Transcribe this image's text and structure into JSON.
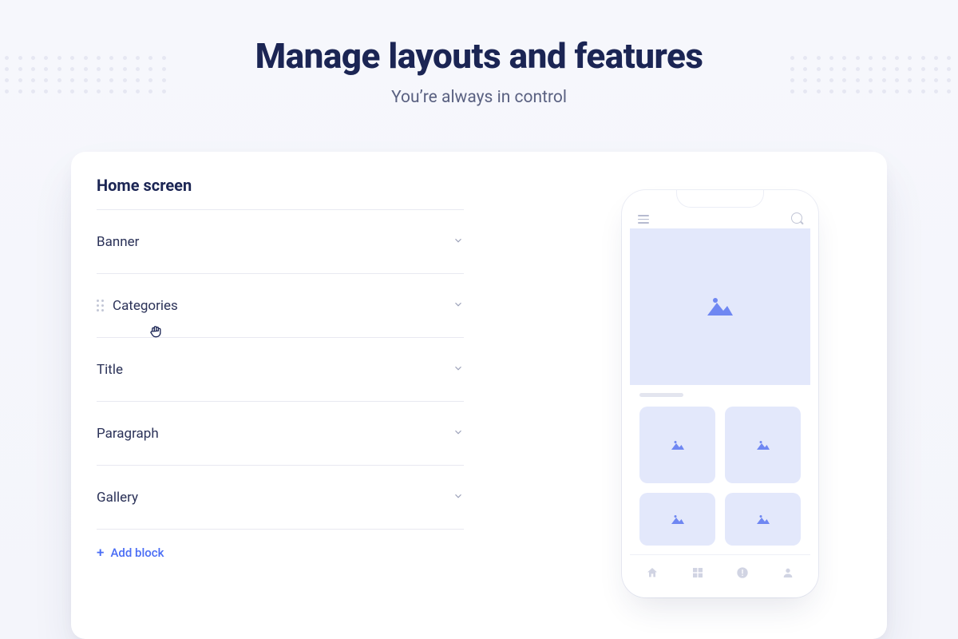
{
  "header": {
    "title": "Manage layouts and features",
    "subtitle": "You’re always in control"
  },
  "panel": {
    "title": "Home screen",
    "add_block_label": "Add block",
    "blocks": [
      {
        "label": "Banner",
        "has_drag": false,
        "has_cursor": false
      },
      {
        "label": "Categories",
        "has_drag": true,
        "has_cursor": true
      },
      {
        "label": "Title",
        "has_drag": false,
        "has_cursor": false
      },
      {
        "label": "Paragraph",
        "has_drag": false,
        "has_cursor": false
      },
      {
        "label": "Gallery",
        "has_drag": false,
        "has_cursor": false
      }
    ]
  },
  "icons": {
    "chevron_down": "chevron-down-icon",
    "plus": "plus-icon",
    "hamburger": "hamburger-icon",
    "search": "search-icon",
    "image_placeholder": "image-placeholder-icon",
    "grab_cursor": "grab-cursor-icon",
    "home": "home-icon",
    "grid": "grid-icon",
    "alert": "alert-icon",
    "user": "user-icon"
  },
  "colors": {
    "primary_text": "#1b2554",
    "secondary_text": "#5a6181",
    "accent": "#4a6df5",
    "placeholder_bg": "#e3e8fb",
    "placeholder_icon": "#7a8ff5"
  }
}
